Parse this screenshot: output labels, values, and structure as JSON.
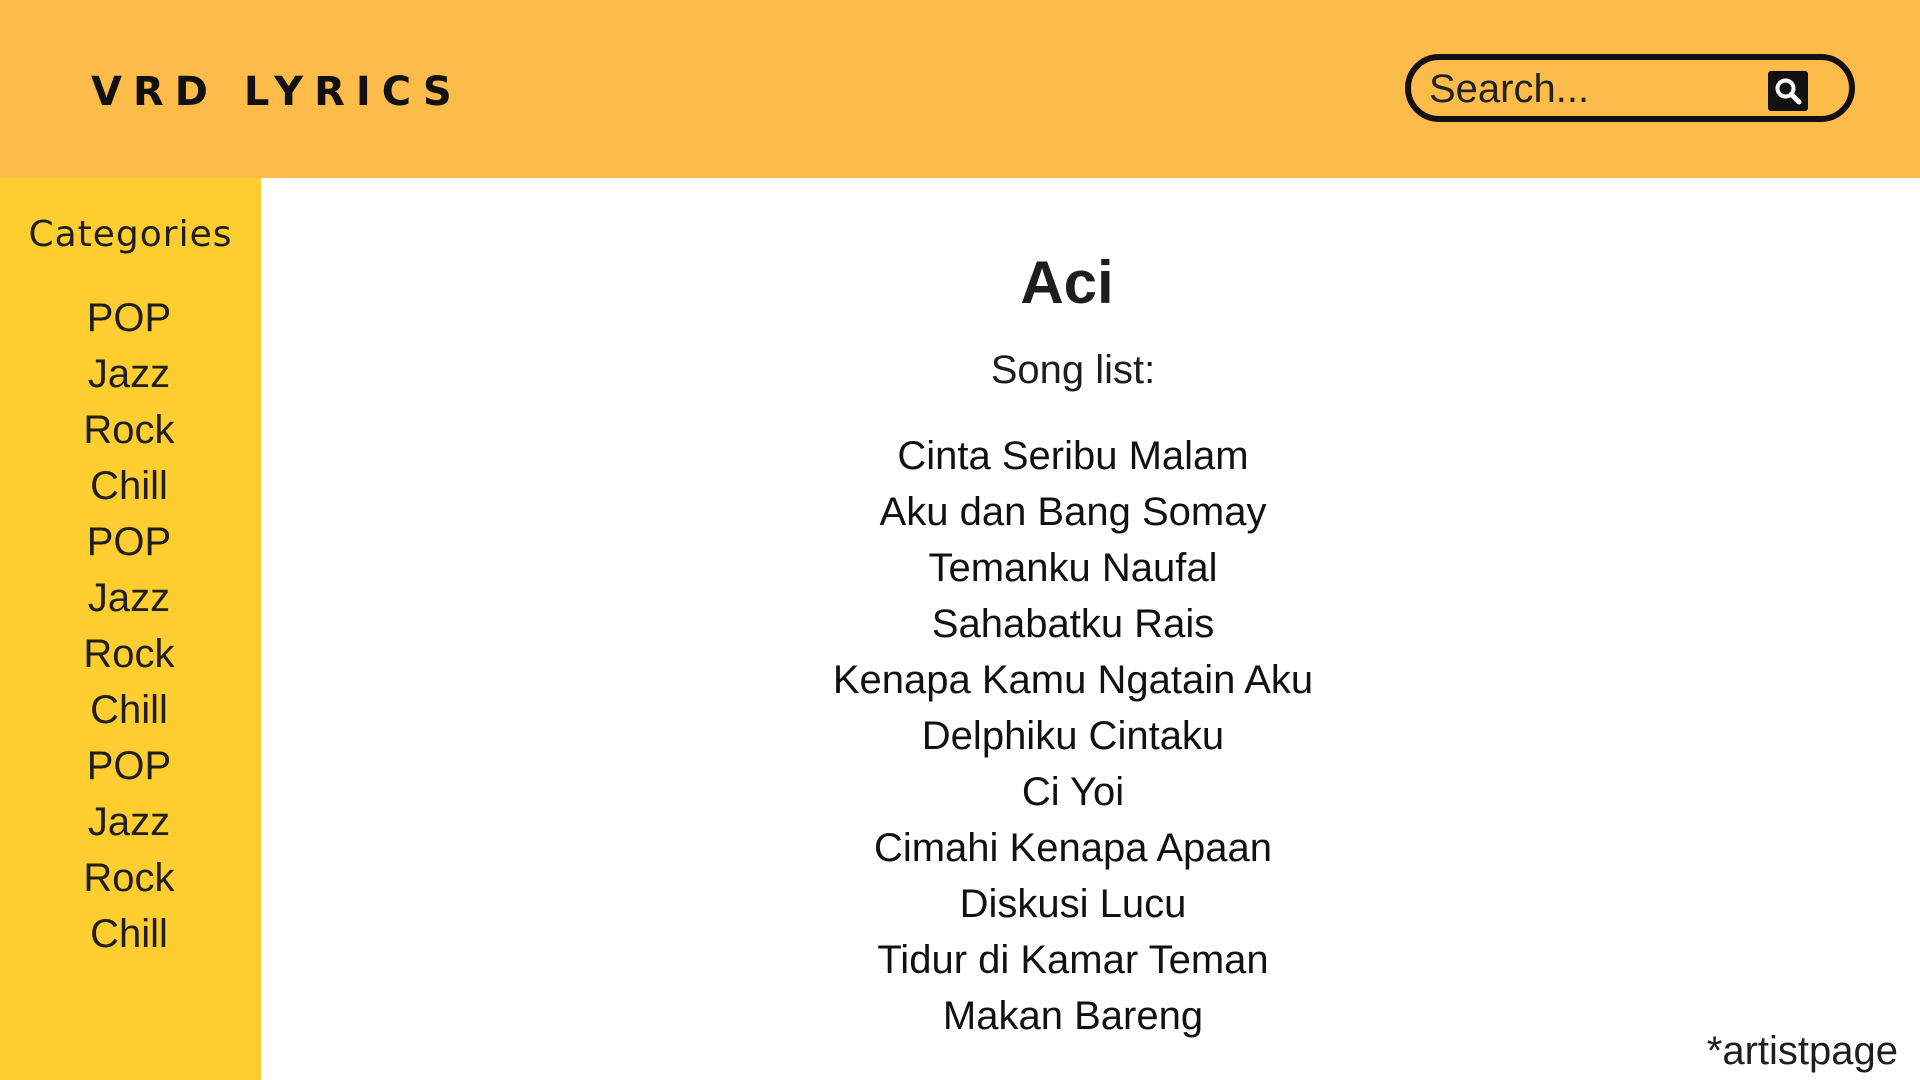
{
  "header": {
    "logo": "VRD LYRICS",
    "search": {
      "placeholder": "Search...",
      "icon": "search-icon"
    }
  },
  "sidebar": {
    "title": "Categories",
    "items": [
      "POP",
      "Jazz",
      "Rock",
      "Chill",
      "POP",
      "Jazz",
      "Rock",
      "Chill",
      "POP",
      "Jazz",
      "Rock",
      "Chill"
    ]
  },
  "main": {
    "artist": "Aci",
    "song_list_label": "Song list:",
    "songs": [
      "Cinta Seribu Malam",
      "Aku dan Bang Somay",
      "Temanku Naufal",
      "Sahabatku Rais",
      "Kenapa Kamu Ngatain Aku",
      "Delphiku Cintaku",
      "Ci Yoi",
      "Cimahi Kenapa Apaan",
      "Diskusi Lucu",
      "Tidur di Kamar Teman",
      "Makan Bareng"
    ]
  },
  "page_note": "*artistpage",
  "colors": {
    "header_bg": "#fdbc4a",
    "sidebar_bg": "#fecd2f",
    "text": "#1e1e1e"
  }
}
